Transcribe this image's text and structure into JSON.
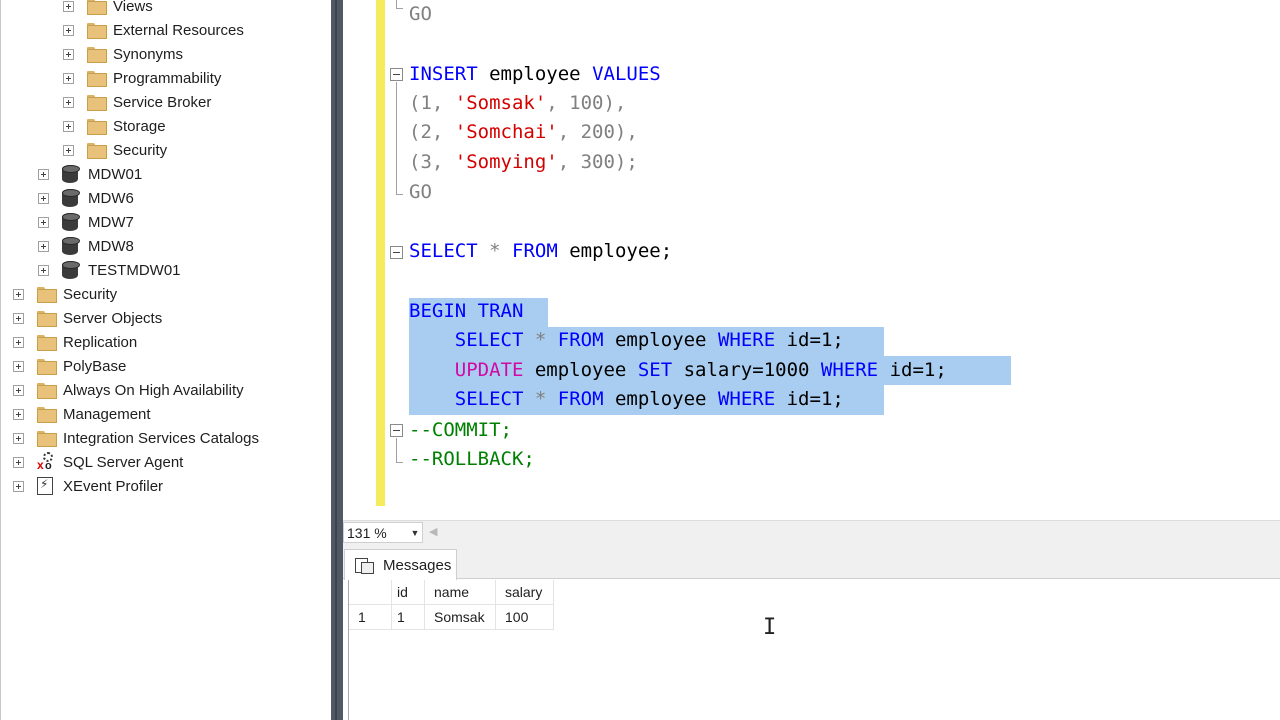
{
  "explorer": {
    "items": [
      {
        "label": "Views",
        "icon": "folder-icon"
      },
      {
        "label": "External Resources",
        "icon": "folder-icon"
      },
      {
        "label": "Synonyms",
        "icon": "folder-icon"
      },
      {
        "label": "Programmability",
        "icon": "folder-icon"
      },
      {
        "label": "Service Broker",
        "icon": "folder-icon"
      },
      {
        "label": "Storage",
        "icon": "folder-icon"
      },
      {
        "label": "Security",
        "icon": "folder-icon"
      },
      {
        "label": "MDW01",
        "icon": "database-icon"
      },
      {
        "label": "MDW6",
        "icon": "database-icon"
      },
      {
        "label": "MDW7",
        "icon": "database-icon"
      },
      {
        "label": "MDW8",
        "icon": "database-icon"
      },
      {
        "label": "TESTMDW01",
        "icon": "database-icon"
      },
      {
        "label": "Security",
        "icon": "folder-icon"
      },
      {
        "label": "Server Objects",
        "icon": "folder-icon"
      },
      {
        "label": "Replication",
        "icon": "folder-icon"
      },
      {
        "label": "PolyBase",
        "icon": "folder-icon"
      },
      {
        "label": "Always On High Availability",
        "icon": "folder-icon"
      },
      {
        "label": "Management",
        "icon": "folder-icon"
      },
      {
        "label": "Integration Services Catalogs",
        "icon": "folder-icon"
      },
      {
        "label": "SQL Server Agent",
        "icon": "sql-agent-icon"
      },
      {
        "label": "XEvent Profiler",
        "icon": "xevent-profiler-icon"
      }
    ]
  },
  "editor": {
    "tokens": {
      "go": "GO",
      "insert": "INSERT",
      "employee": "employee",
      "values": "VALUES",
      "row1_open": "(1, ",
      "row1_str": "'Somsak'",
      "row1_close": ", 100),",
      "row2_open": "(2, ",
      "row2_str": "'Somchai'",
      "row2_close": ", 200),",
      "row3_open": "(3, ",
      "row3_str": "'Somying'",
      "row3_close": ", 300);",
      "select": "SELECT",
      "star": "*",
      "from": "FROM",
      "employee_semi": "employee;",
      "begin_tran": "BEGIN TRAN",
      "where": "WHERE",
      "id_eq": "id=",
      "one_semi": "1;",
      "update": "UPDATE",
      "set": "SET",
      "salary_eq": "salary=",
      "thousand": "1000",
      "commit": "--COMMIT;",
      "rollback": "--ROLLBACK;"
    }
  },
  "zoom": {
    "value": "131 %"
  },
  "results": {
    "tab_label": "Messages",
    "columns": [
      "",
      "id",
      "name",
      "salary"
    ],
    "rows": [
      [
        "1",
        "1",
        "Somsak",
        "100"
      ]
    ]
  }
}
